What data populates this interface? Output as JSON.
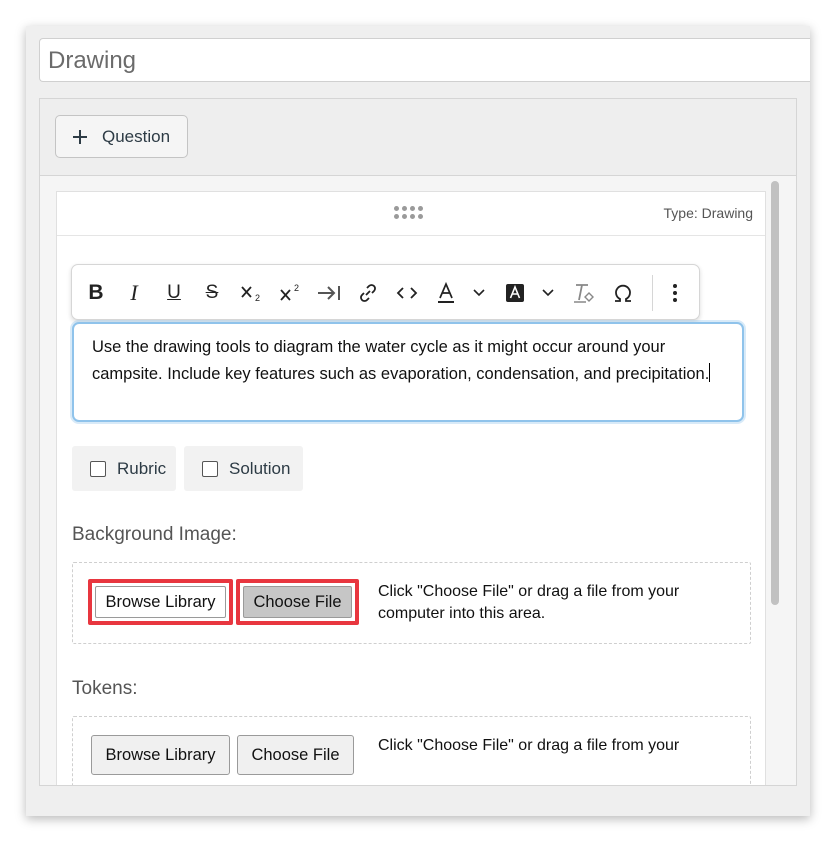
{
  "title_value": "Drawing",
  "header": {
    "add_question_label": "Question"
  },
  "card": {
    "type_label": "Type: Drawing"
  },
  "toolbar": {
    "items": [
      {
        "name": "bold",
        "glyph": "B"
      },
      {
        "name": "italic",
        "glyph": "I"
      },
      {
        "name": "underline",
        "glyph": "U"
      },
      {
        "name": "strikethrough",
        "glyph": "S"
      }
    ]
  },
  "editor": {
    "text": "Use the drawing tools to diagram the water cycle as it might occur around your campsite. Include key features such as evaporation, condensation, and precipitation."
  },
  "options": {
    "rubric_label": "Rubric",
    "solution_label": "Solution"
  },
  "background_image": {
    "label": "Background Image:",
    "browse_label": "Browse Library",
    "choose_label": "Choose File",
    "hint_line1": "Click \"Choose File\" or drag a file from your",
    "hint_line2": "computer into this area."
  },
  "tokens": {
    "label": "Tokens:",
    "browse_label": "Browse Library",
    "choose_label": "Choose File",
    "hint_line1": "Click \"Choose File\" or drag a file from your"
  },
  "colors": {
    "highlight": "#e8363f",
    "focus": "#8fc3eb"
  }
}
